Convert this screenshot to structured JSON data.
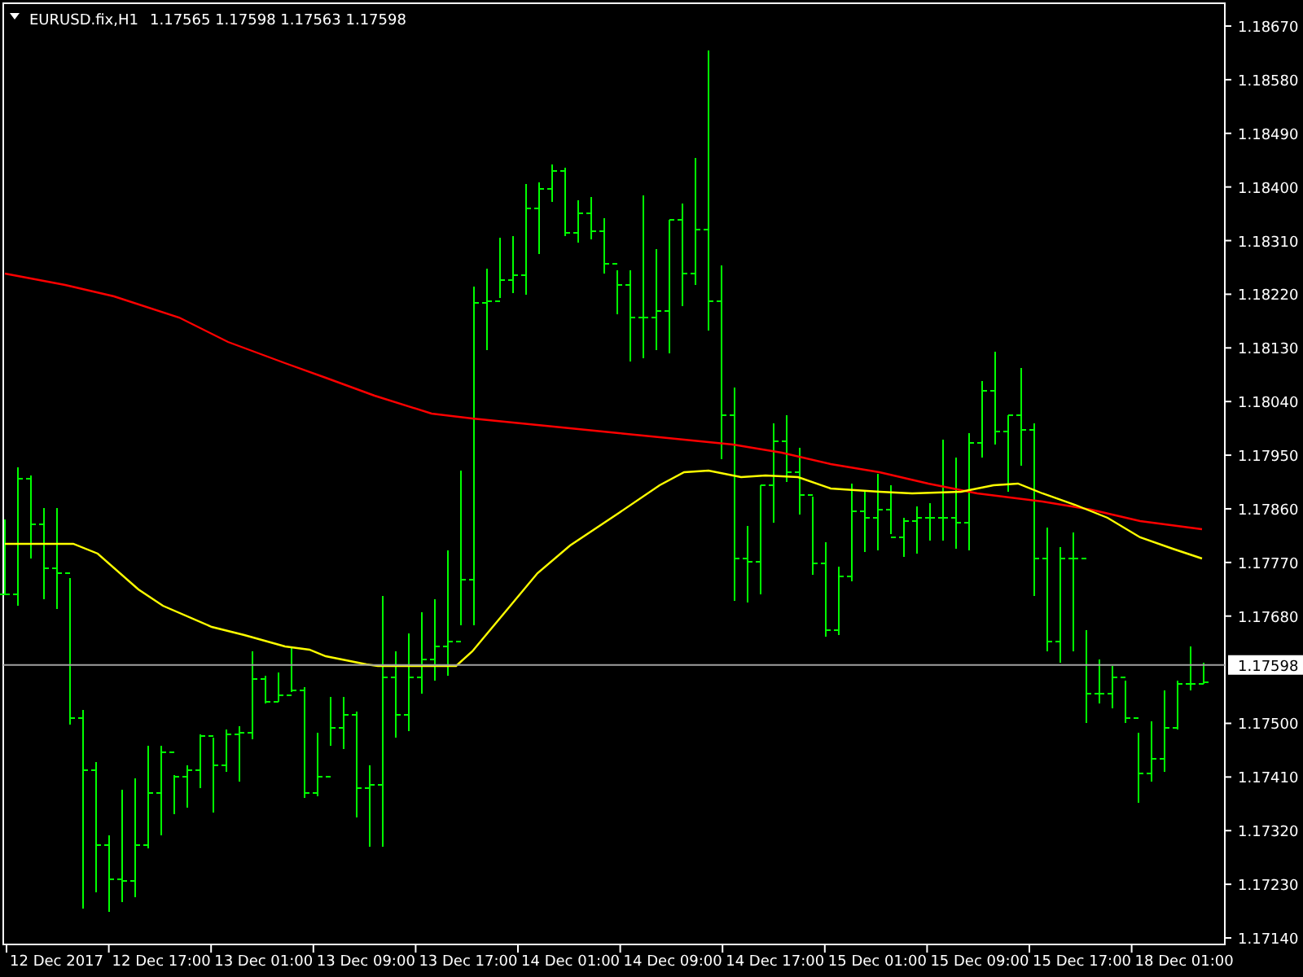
{
  "chart_header": {
    "symbol": "EURUSD.fix,H1",
    "prices": "1.17565 1.17598 1.17563 1.17598"
  },
  "price_axis": {
    "ticks": [
      "1.18670",
      "1.18580",
      "1.18490",
      "1.18400",
      "1.18310",
      "1.18220",
      "1.18130",
      "1.18040",
      "1.17950",
      "1.17860",
      "1.17770",
      "1.17680",
      "1.17500",
      "1.17410",
      "1.17320",
      "1.17230",
      "1.17140"
    ],
    "current_price": "1.17598"
  },
  "time_axis": {
    "labels": [
      "12 Dec 2017",
      "12 Dec 17:00",
      "13 Dec 01:00",
      "13 Dec 09:00",
      "13 Dec 17:00",
      "14 Dec 01:00",
      "14 Dec 09:00",
      "14 Dec 17:00",
      "15 Dec 01:00",
      "15 Dec 09:00",
      "15 Dec 17:00",
      "18 Dec 01:00"
    ]
  }
}
